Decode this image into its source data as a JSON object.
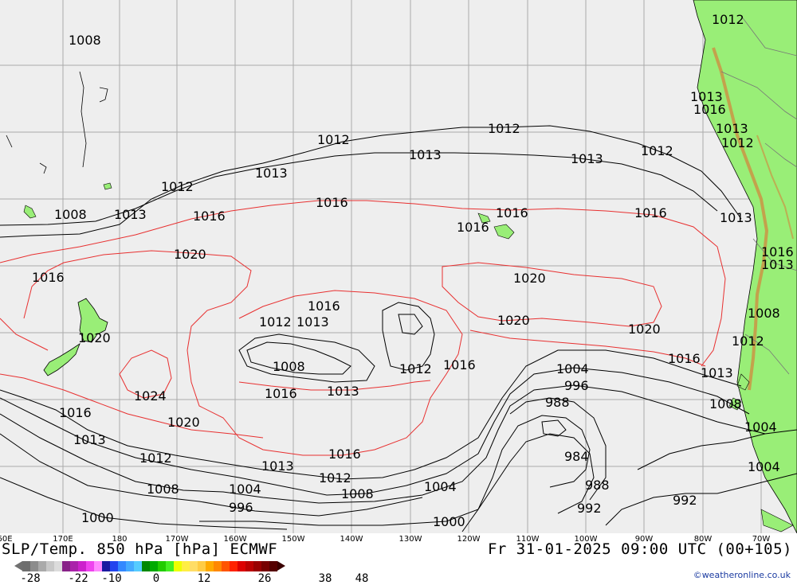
{
  "map": {
    "title_left": "SLP/Temp. 850 hPa [hPa] ECMWF",
    "title_right": "Fr 31-01-2025 09:00 UTC (00+105)",
    "credit": "©weatheronline.co.uk",
    "colors": {
      "ocean": "#eeeeee",
      "land": "#99ee77",
      "grid": "#aaaaaa",
      "isobar": "#000000",
      "isotherm_warm": "#e83030",
      "coast": "#000000"
    },
    "longitude_labels": [
      "60E",
      "170E",
      "180",
      "170W",
      "160W",
      "150W",
      "140W",
      "130W",
      "120W",
      "110W",
      "100W",
      "90W",
      "80W",
      "70W"
    ],
    "colorbar": {
      "tick_labels": [
        "-28",
        "-22",
        "-10",
        "0",
        "12",
        "26",
        "38",
        "48"
      ],
      "colors": [
        "#6e6e6e",
        "#8c8c8c",
        "#aaaaaa",
        "#c8c8c8",
        "#dcdcdc",
        "#882288",
        "#aa22aa",
        "#cc22cc",
        "#ee44ee",
        "#ff88ff",
        "#1a1aa0",
        "#2244ee",
        "#3388ff",
        "#44aaff",
        "#55ccff",
        "#008800",
        "#00aa00",
        "#22cc00",
        "#44ee22",
        "#eeff00",
        "#ffee44",
        "#ffdd66",
        "#ffcc44",
        "#ffaa00",
        "#ff8800",
        "#ff5500",
        "#ff2200",
        "#dd0000",
        "#bb0000",
        "#990000",
        "#770000",
        "#550000"
      ]
    },
    "isobar_labels": [
      "1008",
      "1012",
      "1013",
      "1016",
      "1013",
      "1012",
      "1013",
      "1016",
      "1012",
      "1013",
      "1016",
      "1012",
      "1013",
      "1013",
      "1012",
      "1016",
      "1013",
      "1016",
      "1016",
      "1016",
      "1020",
      "1013",
      "1008",
      "1012",
      "1020",
      "1013",
      "1012",
      "1016",
      "1020",
      "1016",
      "1016",
      "1020",
      "1020",
      "1008",
      "1012",
      "1016",
      "1008",
      "1024",
      "1013",
      "1004",
      "1016",
      "1013",
      "1016",
      "996",
      "1020",
      "988",
      "1008",
      "1012",
      "1016",
      "1004",
      "1008",
      "1013",
      "1012",
      "1004",
      "1013",
      "984",
      "1012",
      "1008",
      "1004",
      "988",
      "992",
      "1000",
      "1000",
      "1004",
      "996",
      "992"
    ]
  }
}
